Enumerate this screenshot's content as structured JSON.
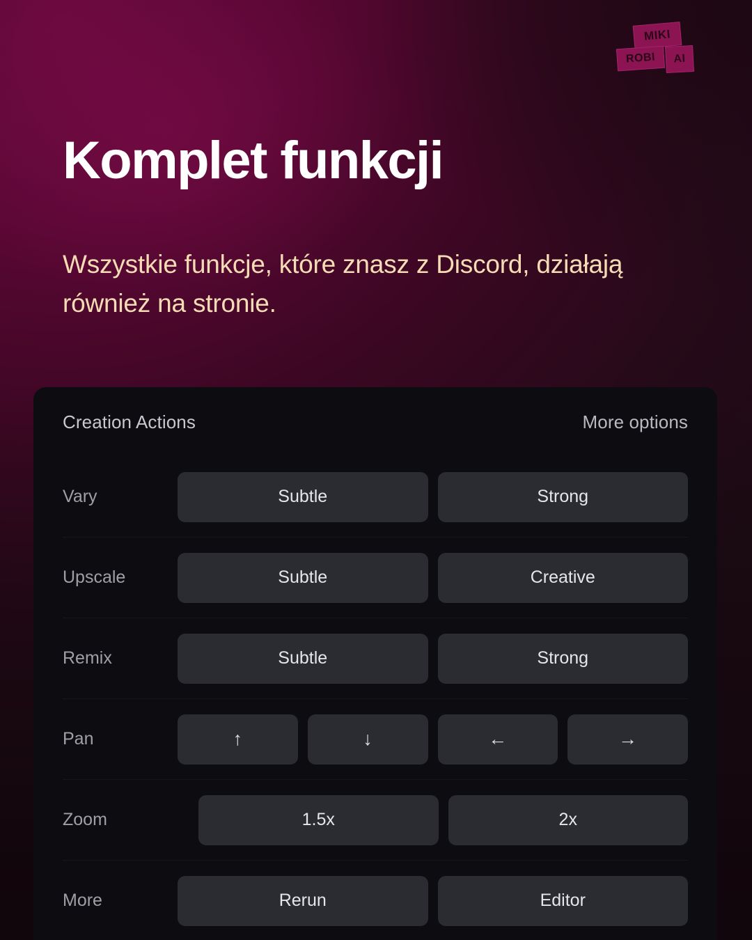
{
  "brand": {
    "logo_line1": "MIKI",
    "logo_line2": "ROBI",
    "logo_line3": "AI",
    "logo_color": "#8d1452"
  },
  "hero": {
    "headline": "Komplet funkcji",
    "subhead": "Wszystkie funkcje, które znasz z Discord, działają również na stronie.",
    "headline_color": "#ffffff",
    "subhead_color": "#f6dcb5"
  },
  "panel": {
    "title": "Creation Actions",
    "more_options": "More options",
    "background": "#0d0d11",
    "button_color": "#2a2c31",
    "rows": [
      {
        "label": "Vary",
        "buttons": [
          {
            "label": "Subtle",
            "icon": ""
          },
          {
            "label": "Strong",
            "icon": ""
          }
        ]
      },
      {
        "label": "Upscale",
        "buttons": [
          {
            "label": "Subtle",
            "icon": ""
          },
          {
            "label": "Creative",
            "icon": ""
          }
        ]
      },
      {
        "label": "Remix",
        "buttons": [
          {
            "label": "Subtle",
            "icon": ""
          },
          {
            "label": "Strong",
            "icon": ""
          }
        ]
      },
      {
        "label": "Pan",
        "buttons": [
          {
            "label": "↑",
            "icon": "arrow-up-icon"
          },
          {
            "label": "↓",
            "icon": "arrow-down-icon"
          },
          {
            "label": "←",
            "icon": "arrow-left-icon"
          },
          {
            "label": "→",
            "icon": "arrow-right-icon"
          }
        ]
      },
      {
        "label": "Zoom",
        "buttons": [
          {
            "label": "1.5x",
            "icon": ""
          },
          {
            "label": "2x",
            "icon": ""
          }
        ]
      },
      {
        "label": "More",
        "buttons": [
          {
            "label": "Rerun",
            "icon": ""
          },
          {
            "label": "Editor",
            "icon": ""
          }
        ]
      }
    ]
  }
}
